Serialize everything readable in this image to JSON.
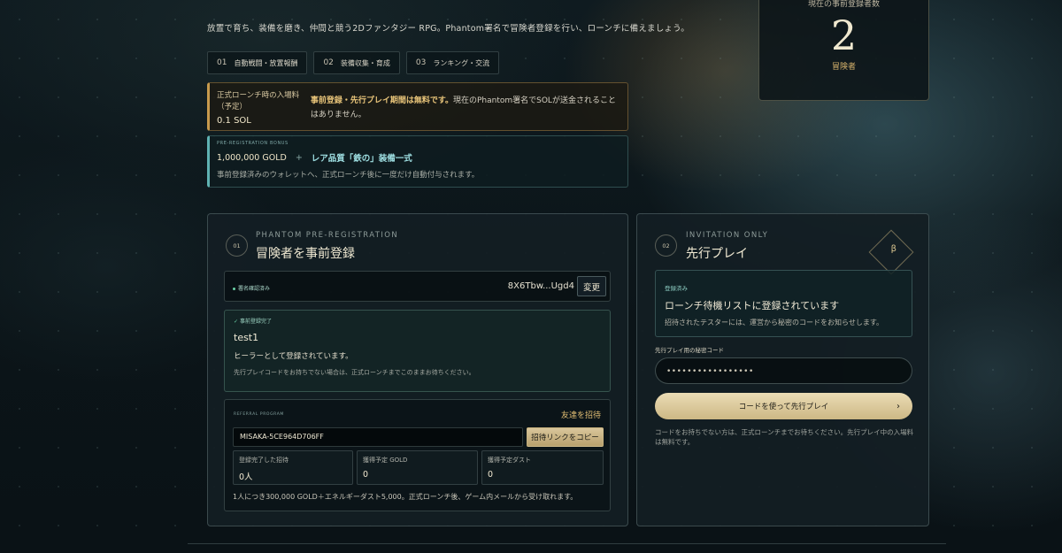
{
  "intro": "放置で育ち、装備を磨き、仲間と競う2Dファンタジー RPG。Phantom署名で冒険者登録を行い、ローンチに備えましょう。",
  "features": [
    {
      "num": "01",
      "label": "自動戦闘・放置報酬"
    },
    {
      "num": "02",
      "label": "装備収集・育成"
    },
    {
      "num": "03",
      "label": "ランキング・交流"
    }
  ],
  "fee": {
    "label": "正式ローンチ時の入場料（予定）",
    "price": "0.1 SOL",
    "highlight": "事前登録・先行プレイ期間は無料です。",
    "note": "現在のPhantom署名でSOLが送金されることはありません。"
  },
  "bonus": {
    "tag": "PRE-REGISTRATION BONUS",
    "gold": "1,000,000 GOLD",
    "plus": "+",
    "item": "レア品質「鉄の」装備一式",
    "desc": "事前登録済みのウォレットへ、正式ローンチ後に一度だけ自動付与されます。"
  },
  "counter": {
    "label": "現在の事前登録者数",
    "value": "2",
    "unit": "冒険者"
  },
  "registration": {
    "step": "01",
    "eyebrow": "PHANTOM PRE-REGISTRATION",
    "title": "冒険者を事前登録",
    "sig_status": "署名確認済み",
    "wallet": "8X6Tbw...Ugd4",
    "change": "変更",
    "done_tag": "事前登録完了",
    "name": "test1",
    "role": "ヒーラーとして登録されています。",
    "note": "先行プレイコードをお持ちでない場合は、正式ローンチまでこのままお待ちください。"
  },
  "referral": {
    "tag": "REFERRAL PROGRAM",
    "invite": "友達を招待",
    "code": "MISAKA-5CE964D706FF",
    "copy": "招待リンクをコピー",
    "stats": [
      {
        "label": "登録完了した招待",
        "value": "0人"
      },
      {
        "label": "獲得予定 GOLD",
        "value": "0"
      },
      {
        "label": "獲得予定ダスト",
        "value": "0"
      }
    ],
    "footer": "1人につき300,000 GOLD＋エネルギーダスト5,000。正式ローンチ後、ゲーム内メールから受け取れます。"
  },
  "early": {
    "step": "02",
    "eyebrow": "INVITATION ONLY",
    "title": "先行プレイ",
    "badge": "β",
    "wait_tag": "登録済み",
    "wait_title": "ローンチ待機リストに登録されています",
    "wait_desc": "招待されたテスターには、運営から秘密のコードをお知らせします。",
    "code_label": "先行プレイ用の秘密コード",
    "code_value": "•••••••••••••••••",
    "play_label": "コードを使って先行プレイ",
    "play_arrow": "›",
    "note": "コードをお持ちでない方は、正式ローンチまでお待ちください。先行プレイ中の入場料は無料です。"
  }
}
